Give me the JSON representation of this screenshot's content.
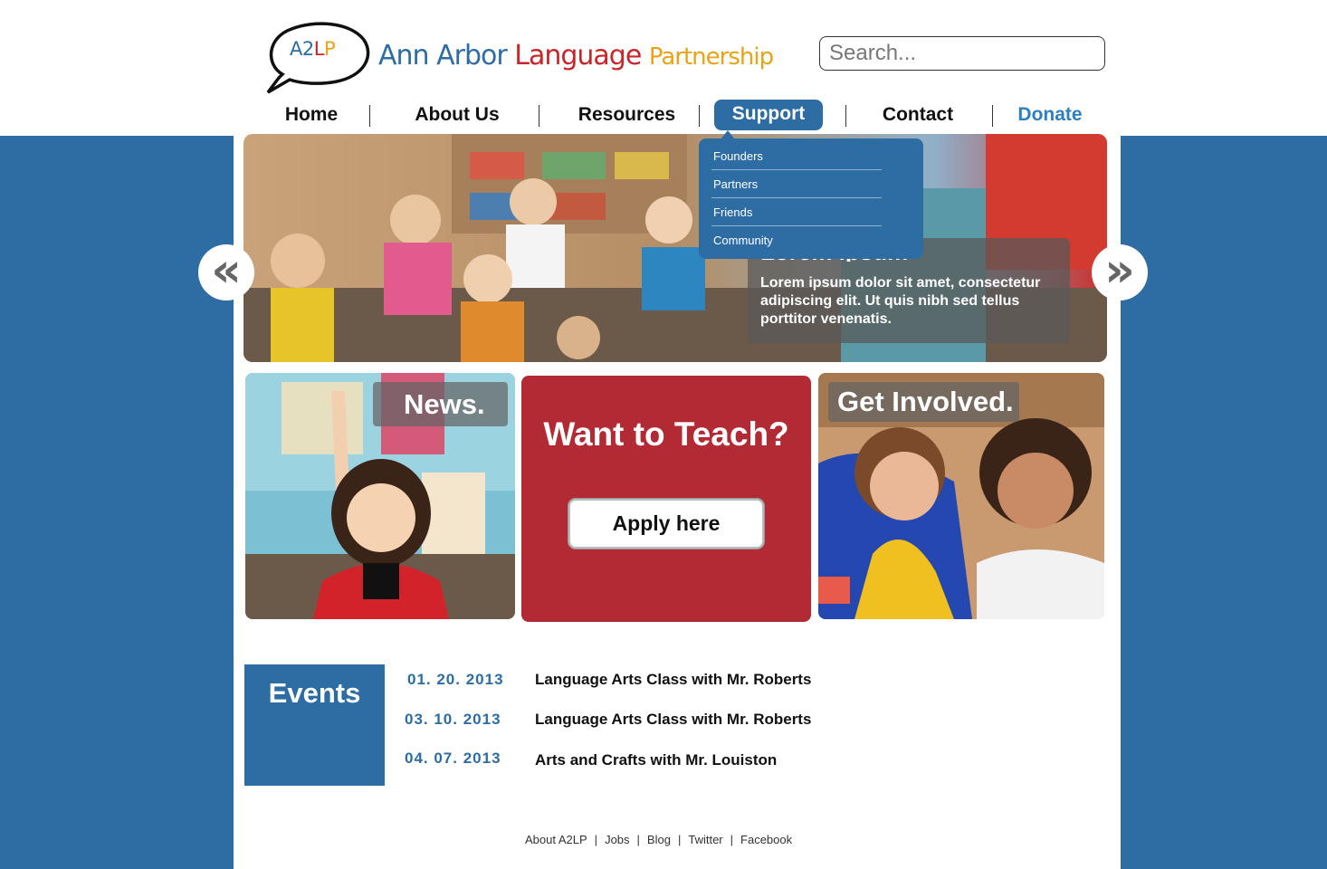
{
  "logo": {
    "badge_a": "A2",
    "badge_b": "L",
    "badge_c": "P"
  },
  "site_title": {
    "w1": "Ann",
    "w2": "Arbor",
    "w3": "Language",
    "w4": "Partnership"
  },
  "search": {
    "placeholder": "Search..."
  },
  "nav": {
    "items": [
      "Home",
      "About Us",
      "Resources",
      "Support",
      "Contact",
      "Donate"
    ],
    "active": "Support"
  },
  "dropdown": {
    "items": [
      "Founders",
      "Partners",
      "Friends",
      "Community"
    ]
  },
  "hero": {
    "caption_title": "Lorem ipsum",
    "caption_body": "Lorem ipsum dolor sit amet, consectetur adipiscing elit. Ut quis nibh sed tellus porttitor venenatis.",
    "prev": "«",
    "next": "»"
  },
  "tiles": {
    "news_label": "News.",
    "teach_title": "Want to Teach?",
    "apply_label": "Apply here",
    "involved_label": "Get Involved."
  },
  "events": {
    "heading": "Events",
    "items": [
      {
        "date": "01. 20. 2013",
        "title": "Language Arts Class with Mr. Roberts"
      },
      {
        "date": "03. 10. 2013",
        "title": "Language Arts Class with Mr. Roberts"
      },
      {
        "date": "04. 07. 2013",
        "title": "Arts and Crafts with Mr. Louiston"
      }
    ]
  },
  "footer": {
    "links": [
      "About A2LP",
      "Jobs",
      "Blog",
      "Twitter",
      "Facebook"
    ],
    "separator": "|"
  },
  "colors": {
    "brand_blue": "#2e6da4",
    "brand_red": "#b22a34",
    "accent_yellow": "#e8a319"
  }
}
